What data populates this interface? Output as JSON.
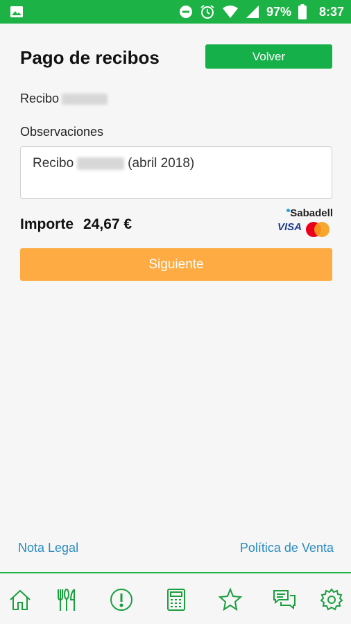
{
  "status_bar": {
    "battery": "97%",
    "time": "8:37",
    "icons": [
      "gallery-icon",
      "dnd-icon",
      "alarm-icon",
      "wifi-icon",
      "signal-icon",
      "battery-icon"
    ]
  },
  "header": {
    "title": "Pago de recibos",
    "back_label": "Volver"
  },
  "recibo_label": "Recibo",
  "observaciones": {
    "label": "Observaciones",
    "text_before": "Recibo",
    "text_after": "(abril 2018)"
  },
  "importe": {
    "label": "Importe",
    "value": "24,67 €"
  },
  "payment_logos": {
    "bank": "Sabadell",
    "card1": "VISA"
  },
  "next_label": "Siguiente",
  "footer": {
    "nota_legal": "Nota Legal",
    "politica": "Política de Venta"
  },
  "nav": [
    "home-icon",
    "restaurant-icon",
    "alert-icon",
    "calculator-icon",
    "favorites-icon",
    "chat-icon",
    "settings-icon"
  ],
  "colors": {
    "status_bar": "#1db245",
    "primary_green": "#16b04a",
    "accent_orange": "#fdab42",
    "link_blue": "#2a8bc0"
  }
}
